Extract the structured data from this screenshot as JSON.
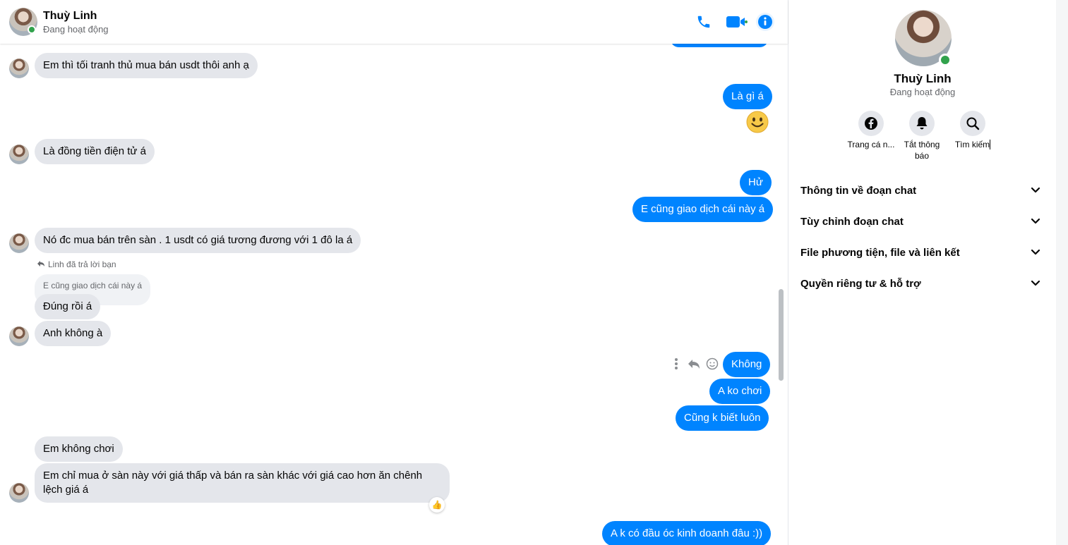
{
  "contact": {
    "name": "Thuỳ Linh",
    "status": "Đang hoạt động"
  },
  "header": {
    "icons": [
      "phone-icon",
      "video-camera-icon",
      "info-icon"
    ]
  },
  "colors": {
    "accent": "#0084ff",
    "online": "#31a24c",
    "incoming_bubble": "#e4e6eb"
  },
  "messages": [
    {
      "from": "contact",
      "text": "Em thì tối tranh thủ mua bán usdt thôi anh ạ"
    },
    {
      "from": "me",
      "text": "Là gì á"
    },
    {
      "from": "me",
      "emoji": "slightly-smiling-face"
    },
    {
      "from": "contact",
      "text": "Là đồng tiền điện tử á"
    },
    {
      "from": "me",
      "text": "Hử"
    },
    {
      "from": "me",
      "text": "E cũng giao dịch cái này á"
    },
    {
      "from": "contact",
      "text": "Nó đc mua bán trên sàn . 1 usdt có giá tương đương với 1 đô la á"
    },
    {
      "from": "contact",
      "reply_note": "Linh đã trả lời bạn",
      "quoted": "E cũng giao dịch cái này á",
      "text": "Đúng rồi á"
    },
    {
      "from": "contact",
      "text": "Anh không à"
    },
    {
      "from": "me",
      "text": "Không"
    },
    {
      "from": "me",
      "text": "A ko chơi"
    },
    {
      "from": "me",
      "text": "Cũng k biết luôn"
    },
    {
      "from": "contact",
      "text": "Em không chơi"
    },
    {
      "from": "contact",
      "text": "Em chỉ mua ở sàn này với giá thấp và  bán ra sàn khác với giá cao hơn ăn chênh lệch giá á",
      "reaction": "👍"
    },
    {
      "from": "me",
      "text": "A k có đầu óc kinh doanh đâu :))"
    }
  ],
  "panel": {
    "name": "Thuỳ Linh",
    "status": "Đang hoạt động",
    "actions": [
      {
        "label": "Trang cá n...",
        "icon": "facebook-icon"
      },
      {
        "label": "Tắt thông báo",
        "icon": "bell-icon"
      },
      {
        "label": "Tìm kiếm",
        "icon": "search-icon"
      }
    ],
    "sections": [
      "Thông tin về đoạn chat",
      "Tùy chỉnh đoạn chat",
      "File phương tiện, file và liên kết",
      "Quyền riêng tư & hỗ trợ"
    ]
  }
}
